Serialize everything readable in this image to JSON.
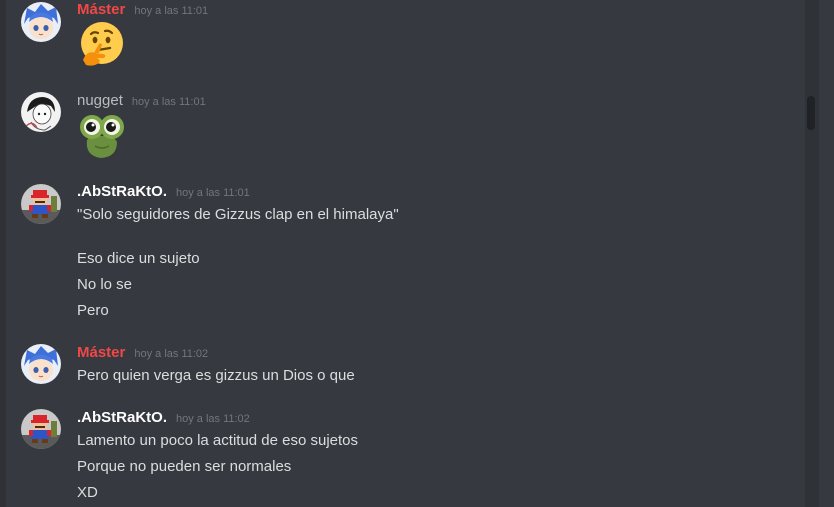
{
  "colors": {
    "background": "#36393f",
    "master_name": "#f04747",
    "default_name": "#ffffff",
    "nugget_name": "#b9bbbe",
    "timestamp": "#72767d",
    "text": "#dcddde"
  },
  "messages": [
    {
      "author": "Máster",
      "timestamp": "hoy a las 11:01",
      "avatar_icon": "anime-avatar-icon",
      "emoji": "thinking-face-emoji"
    },
    {
      "author": "nugget",
      "timestamp": "hoy a las 11:01",
      "avatar_icon": "sketch-avatar-icon",
      "emoji": "frog-eyes-emoji"
    },
    {
      "author": ".AbStRaKtO.",
      "timestamp": "hoy a las 11:01",
      "avatar_icon": "pixel-mario-avatar-icon",
      "lines": [
        "\"Solo seguidores de Gizzus clap en el himalaya\"",
        "Eso dice un sujeto",
        "No lo se",
        "Pero"
      ]
    },
    {
      "author": "Máster",
      "timestamp": "hoy a las 11:02",
      "avatar_icon": "anime-avatar-icon",
      "lines": [
        "Pero quien verga es gizzus un Dios o que"
      ]
    },
    {
      "author": ".AbStRaKtO.",
      "timestamp": "hoy a las 11:02",
      "avatar_icon": "pixel-mario-avatar-icon",
      "lines": [
        "Lamento un poco la actitud de eso sujetos",
        "Porque no pueden ser normales",
        "XD"
      ]
    }
  ]
}
